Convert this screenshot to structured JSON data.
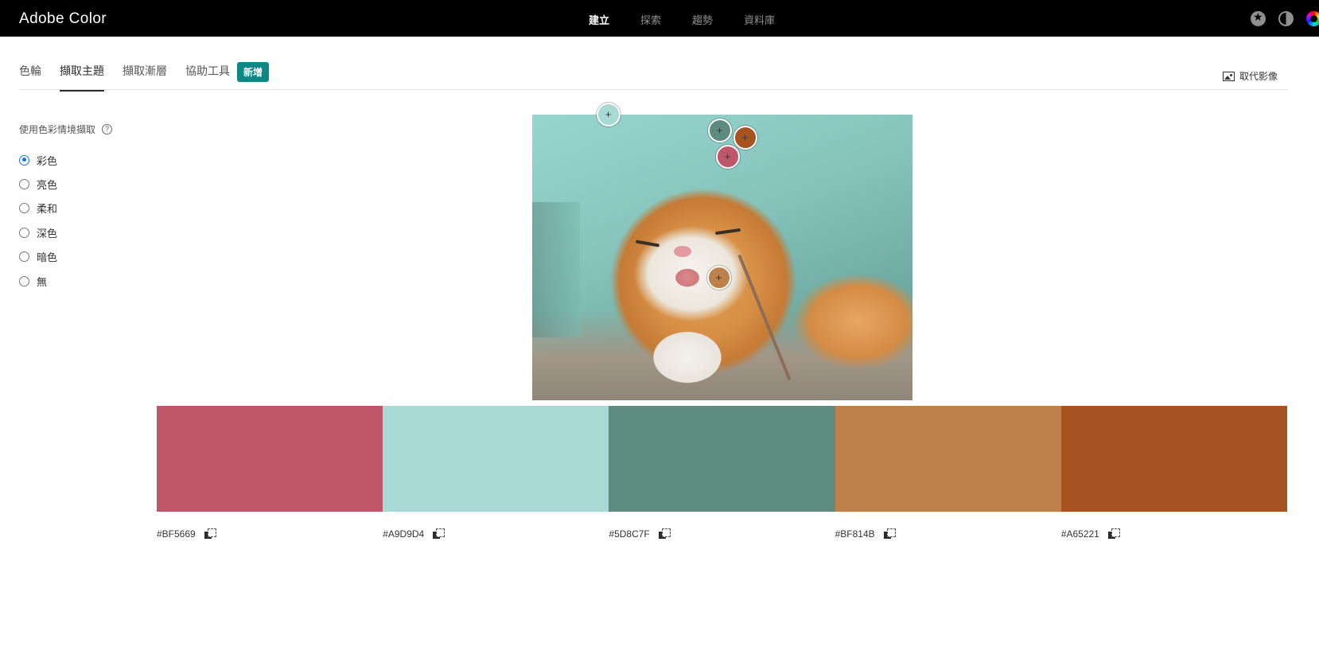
{
  "app": {
    "brand": "Adobe Color",
    "nav": [
      "建立",
      "探索",
      "趨勢",
      "資料庫"
    ],
    "nav_active": 0,
    "icons": [
      "star-icon",
      "contrast-icon",
      "color-wheel-icon"
    ]
  },
  "tabs": {
    "items": [
      "色輪",
      "擷取主題",
      "擷取漸層",
      "協助工具"
    ],
    "active": 1,
    "badge": "新增",
    "replace_image_label": "取代影像"
  },
  "mood": {
    "title": "使用色彩情境擷取",
    "help": "?",
    "options": [
      "彩色",
      "亮色",
      "柔和",
      "深色",
      "暗色",
      "無"
    ],
    "selected": 0
  },
  "theme": {
    "colors": [
      "#BF5669",
      "#A9D9D4",
      "#5D8C7F",
      "#BF814B",
      "#A65221"
    ]
  },
  "colors": {
    "accent": "#1473e6",
    "badge": "#0e8787",
    "topbar": "#000000"
  }
}
